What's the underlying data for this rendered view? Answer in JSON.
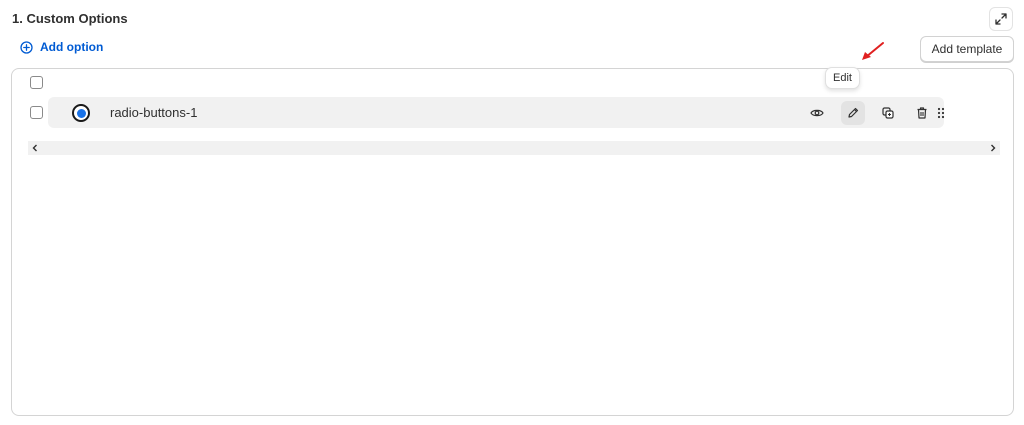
{
  "header": {
    "title": "1. Custom Options",
    "add_option_label": "Add option",
    "add_template_label": "Add template"
  },
  "options": [
    {
      "type_icon": "radio-icon",
      "label": "radio-buttons-1",
      "checked": false
    }
  ],
  "row_actions": {
    "icons": [
      "eye-icon",
      "pencil-icon",
      "duplicate-icon",
      "trash-icon",
      "drag-handle-icon"
    ],
    "tooltip": "Edit"
  },
  "colors": {
    "accent": "#005bd3",
    "radio_fill": "#1a73e8",
    "annotation_arrow": "#e02020"
  }
}
